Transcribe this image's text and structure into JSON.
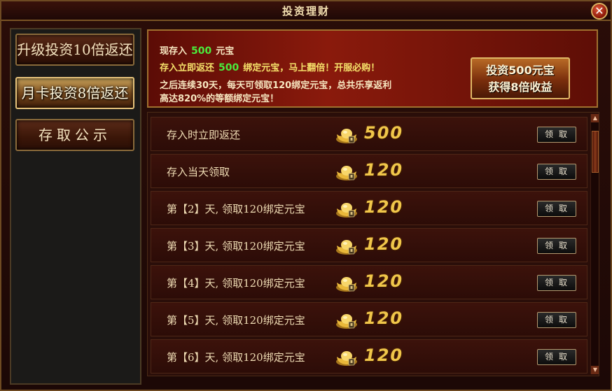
{
  "window": {
    "title": "投资理财",
    "close_symbol": "✕"
  },
  "menu": [
    {
      "label": "升级投资10倍返还",
      "active": false
    },
    {
      "label": "月卡投资8倍返还",
      "active": true
    },
    {
      "label": "存取公示",
      "active": false
    }
  ],
  "banner": {
    "line1_prefix": "现存入",
    "line1_amount": "500",
    "line1_suffix": "元宝",
    "line2_prefix": "存入立即返还",
    "line2_amount": "500",
    "line2_suffix": "绑定元宝，马上翻倍！开服必购！",
    "line3": "之后连续30天，每天可领取120绑定元宝，总共乐享返利",
    "line4": "高达820%的等额绑定元宝！",
    "invest_button_line1": "投资500元宝",
    "invest_button_line2": "获得8倍收益"
  },
  "rewards": {
    "claim_label": "领取",
    "rows": [
      {
        "label": "存入时立即返还",
        "amount": "500"
      },
      {
        "label": "存入当天领取",
        "amount": "120"
      },
      {
        "label": "第【2】天, 领取120绑定元宝",
        "amount": "120"
      },
      {
        "label": "第【3】天, 领取120绑定元宝",
        "amount": "120"
      },
      {
        "label": "第【4】天, 领取120绑定元宝",
        "amount": "120"
      },
      {
        "label": "第【5】天, 领取120绑定元宝",
        "amount": "120"
      },
      {
        "label": "第【6】天, 领取120绑定元宝",
        "amount": "120"
      }
    ]
  },
  "icons": {
    "currency": "gold-ingot-icon",
    "close": "close-icon"
  },
  "colors": {
    "highlight_green": "#4bea3c",
    "amount_gold": "#f0c64a",
    "banner_red": "#8a1a0c"
  }
}
